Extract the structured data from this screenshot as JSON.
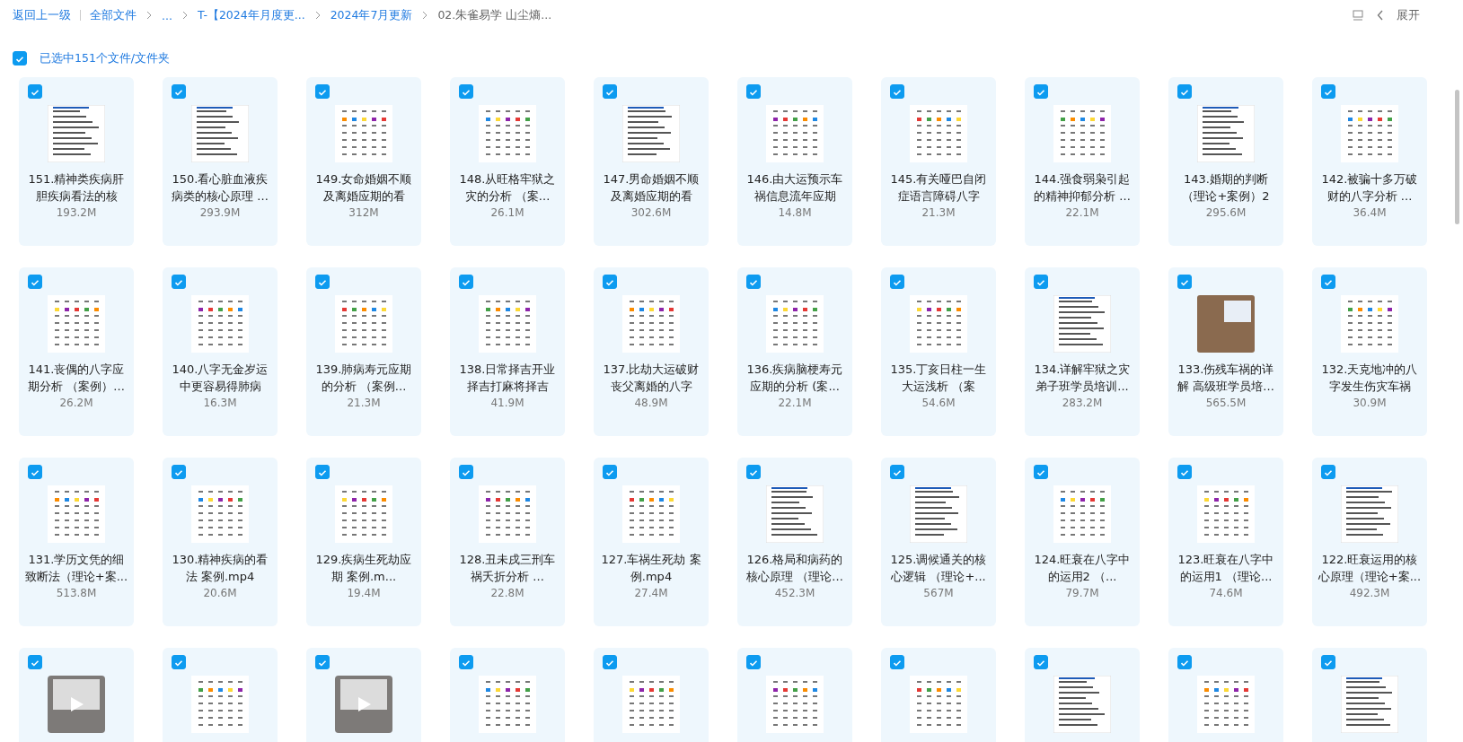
{
  "breadcrumb": {
    "back": "返回上一级",
    "items": [
      {
        "label": "全部文件",
        "current": false
      },
      {
        "label": "...",
        "current": false
      },
      {
        "label": "T-【2024年月度更...",
        "current": false
      },
      {
        "label": "2024年7月更新",
        "current": false
      },
      {
        "label": "02.朱雀易学 山尘熵...",
        "current": true
      }
    ]
  },
  "toolbar": {
    "expand": "展开"
  },
  "selection": {
    "checked": true,
    "label": "已选中151个文件/文件夹"
  },
  "files": [
    {
      "name": "151.精神类疾病肝胆疾病看法的核",
      "size": "193.2M",
      "kind": "doc",
      "checked": true
    },
    {
      "name": "150.看心脏血液疾病类的核心原理 ...",
      "size": "293.9M",
      "kind": "doc",
      "checked": true
    },
    {
      "name": "149.女命婚姻不顺及离婚应期的看",
      "size": "312M",
      "kind": "chart",
      "checked": true
    },
    {
      "name": "148.从旺格牢狱之灾的分析 （案...",
      "size": "26.1M",
      "kind": "chart",
      "checked": true
    },
    {
      "name": "147.男命婚姻不顺及离婚应期的看",
      "size": "302.6M",
      "kind": "doc",
      "checked": true
    },
    {
      "name": "146.由大运预示车祸信息流年应期",
      "size": "14.8M",
      "kind": "chart",
      "checked": true
    },
    {
      "name": "145.有关哑巴自闭症语言障碍八字",
      "size": "21.3M",
      "kind": "chart",
      "checked": true
    },
    {
      "name": "144.强食弱枭引起的精神抑郁分析 ...",
      "size": "22.1M",
      "kind": "chart",
      "checked": true
    },
    {
      "name": "143.婚期的判断（理论+案例）2",
      "size": "295.6M",
      "kind": "doc",
      "checked": true
    },
    {
      "name": "142.被骗十多万破财的八字分析 ...",
      "size": "36.4M",
      "kind": "chart",
      "checked": true
    },
    {
      "name": "141.丧偶的八字应期分析 （案例）...",
      "size": "26.2M",
      "kind": "chart",
      "checked": true
    },
    {
      "name": "140.八字无金岁运中更容易得肺病",
      "size": "16.3M",
      "kind": "chart",
      "checked": true
    },
    {
      "name": "139.肺病寿元应期的分析 （案例...",
      "size": "21.3M",
      "kind": "chart",
      "checked": true
    },
    {
      "name": "138.日常择吉开业择吉打麻将择吉",
      "size": "41.9M",
      "kind": "chart",
      "checked": true
    },
    {
      "name": "137.比劫大运破财丧父离婚的八字",
      "size": "48.9M",
      "kind": "chart",
      "checked": true
    },
    {
      "name": "136.疾病脑梗寿元应期的分析 (案...",
      "size": "22.1M",
      "kind": "chart",
      "checked": true
    },
    {
      "name": "135.丁亥日柱一生大运浅析 （案",
      "size": "54.6M",
      "kind": "chart",
      "checked": true
    },
    {
      "name": "134.详解牢狱之灾弟子班学员培训...",
      "size": "283.2M",
      "kind": "doc",
      "checked": true
    },
    {
      "name": "133.伤残车祸的详解 高级班学员培...",
      "size": "565.5M",
      "kind": "photo",
      "checked": true
    },
    {
      "name": "132.天克地冲的八字发生伤灾车祸",
      "size": "30.9M",
      "kind": "chart",
      "checked": true
    },
    {
      "name": "131.学历文凭的细致断法（理论+案...",
      "size": "513.8M",
      "kind": "chart",
      "checked": true
    },
    {
      "name": "130.精神疾病的看法 案例.mp4",
      "size": "20.6M",
      "kind": "chart",
      "checked": true
    },
    {
      "name": "129.疾病生死劫应期 案例.m...",
      "size": "19.4M",
      "kind": "chart",
      "checked": true
    },
    {
      "name": "128.丑未戌三刑车祸夭折分析 ...",
      "size": "22.8M",
      "kind": "chart",
      "checked": true
    },
    {
      "name": "127.车祸生死劫 案例.mp4",
      "size": "27.4M",
      "kind": "chart",
      "checked": true
    },
    {
      "name": "126.格局和病药的核心原理 （理论...",
      "size": "452.3M",
      "kind": "doc",
      "checked": true
    },
    {
      "name": "125.调候通关的核心逻辑 （理论+...",
      "size": "567M",
      "kind": "doc",
      "checked": true
    },
    {
      "name": "124.旺衰在八字中的运用2 （...",
      "size": "79.7M",
      "kind": "chart",
      "checked": true
    },
    {
      "name": "123.旺衰在八字中的运用1 （理论...",
      "size": "74.6M",
      "kind": "chart",
      "checked": true
    },
    {
      "name": "122.旺衰运用的核心原理（理论+案...",
      "size": "492.3M",
      "kind": "doc",
      "checked": true
    },
    {
      "kind": "video",
      "checked": true
    },
    {
      "kind": "chart",
      "checked": true
    },
    {
      "kind": "video",
      "checked": true
    },
    {
      "kind": "chart",
      "checked": true
    },
    {
      "kind": "chart",
      "checked": true
    },
    {
      "kind": "chart",
      "checked": true
    },
    {
      "kind": "chart",
      "checked": true
    },
    {
      "kind": "doc",
      "checked": true
    },
    {
      "kind": "chart",
      "checked": true
    },
    {
      "kind": "doc",
      "checked": true
    }
  ]
}
